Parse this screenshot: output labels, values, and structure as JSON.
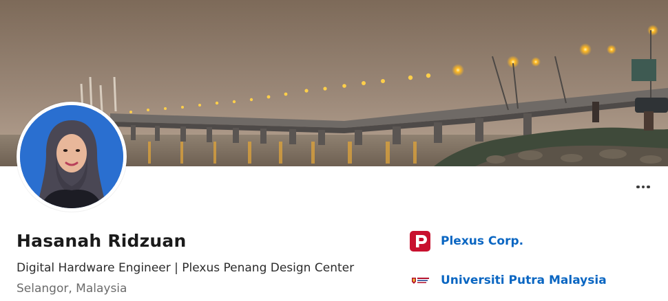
{
  "profile": {
    "name": "Hasanah Ridzuan",
    "headline": "Digital Hardware Engineer | Plexus Penang Design Center",
    "location": "Selangor, Malaysia"
  },
  "current_company": {
    "name": "Plexus Corp.",
    "logo_icon": "plexus-logo-icon",
    "logo_color": "#c8102e"
  },
  "education": {
    "name": "Universiti Putra Malaysia",
    "logo_icon": "upm-crest-icon"
  },
  "menu": {
    "more_icon": "more-horizontal-icon"
  },
  "colors": {
    "link": "#0a66c2",
    "name_text": "#1b1b1b",
    "secondary_text": "#6b6b6b"
  }
}
